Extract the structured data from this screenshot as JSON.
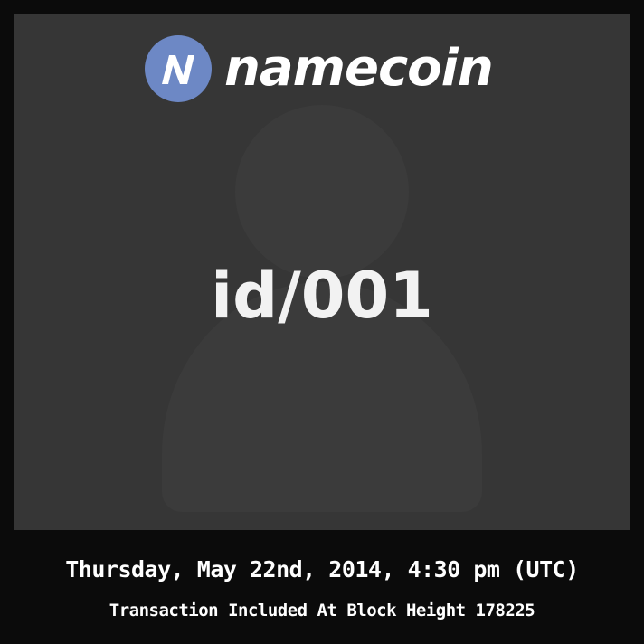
{
  "logo": {
    "icon": "namecoin-n-logo-icon",
    "text": "namecoin",
    "icon_color": "#6d88c5"
  },
  "card": {
    "name": "id/001",
    "placeholder_icon": "user-silhouette-icon"
  },
  "footer": {
    "date": "Thursday, May 22nd, 2014, 4:30 pm (UTC)",
    "transaction": "Transaction Included At Block Height 178225"
  }
}
